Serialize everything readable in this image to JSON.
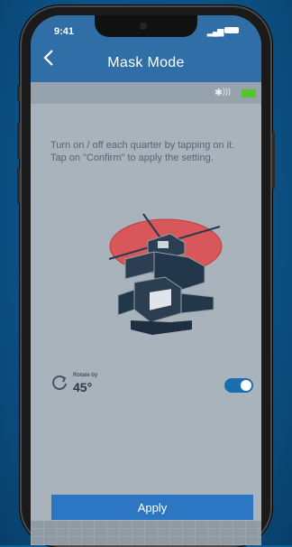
{
  "status_bar": {
    "time": "9:41",
    "signal_icon": "signal-bars-icon",
    "battery_icon": "battery-icon"
  },
  "nav": {
    "title": "Mask Mode",
    "back_icon": "chevron-left-icon"
  },
  "device_status": {
    "bluetooth_icon": "bluetooth-icon",
    "battery_color": "#52c52a"
  },
  "instructions": "Turn on / off each quarter by tapping on it. Tap on \"Confirm\" to apply the setting.",
  "rotation": {
    "label": "Rotate by",
    "value": "45°",
    "icon": "rotate-icon"
  },
  "toggle": {
    "state": "on"
  },
  "apply_button": {
    "label": "Apply"
  },
  "colors": {
    "accent": "#2d76c4",
    "header": "#2f6ea6",
    "mask": "#e0474a"
  }
}
